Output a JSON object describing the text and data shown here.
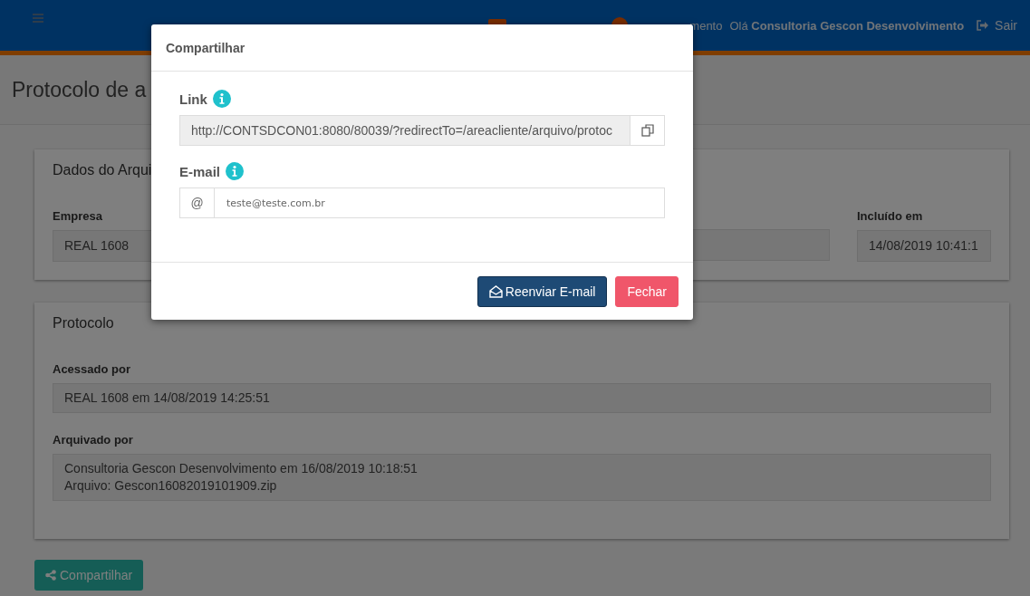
{
  "header": {
    "partial_item": "mento",
    "greeting": "Olá",
    "user": "Consultoria Gescon Desenvolvimento",
    "logout": "Sair"
  },
  "page_title": "Protocolo de a",
  "file_card": {
    "title": "Dados do Arqui",
    "fields": [
      {
        "label": "Empresa",
        "value": "REAL 1608"
      },
      {
        "label": "Incluído em",
        "value": "14/08/2019 10:41:1"
      }
    ]
  },
  "protocol_card": {
    "title": "Protocolo",
    "fields": [
      {
        "label": "Acessado por",
        "lines": [
          "REAL 1608 em 14/08/2019 14:25:51"
        ]
      },
      {
        "label": "Arquivado por",
        "lines": [
          "Consultoria Gescon Desenvolvimento em 16/08/2019 10:18:51",
          "Arquivo: Gescon16082019101909.zip"
        ]
      }
    ]
  },
  "share_button": "Compartilhar",
  "modal": {
    "title": "Compartilhar",
    "link": {
      "label": "Link",
      "value": "http://CONTSDCON01:8080/80039/?redirectTo=/areacliente/arquivo/protoc"
    },
    "email": {
      "label": "E-mail",
      "addon": "@",
      "value": "teste@teste.com.br"
    },
    "buttons": [
      {
        "kind": "primary",
        "label": "Reenviar E-mail"
      },
      {
        "kind": "danger",
        "label": "Fechar"
      }
    ]
  }
}
